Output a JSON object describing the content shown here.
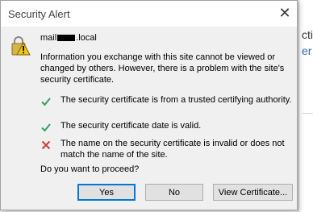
{
  "dialog": {
    "title": "Security Alert",
    "close_glyph": "✕",
    "host_prefix": "mail",
    "host_suffix": ".local",
    "info": "Information you exchange with this site cannot be viewed or changed by others. However, there is a problem with the site's security certificate.",
    "checks": [
      {
        "status": "ok",
        "icon": "check-icon",
        "text": "The security certificate is from a trusted certifying authority."
      },
      {
        "status": "ok",
        "icon": "check-icon",
        "text": "The security certificate date is valid."
      },
      {
        "status": "error",
        "icon": "x-icon",
        "text": "The name on the security certificate is invalid or does not match the name of the site."
      }
    ],
    "question": "Do you want to proceed?",
    "buttons": {
      "yes": "Yes",
      "no": "No",
      "view": "View Certificate..."
    }
  },
  "background": {
    "text_fragment_1": "ctio",
    "text_fragment_2": "er"
  },
  "colors": {
    "ok": "#3c9d64",
    "error": "#d23a2c",
    "accent": "#0078d7"
  }
}
